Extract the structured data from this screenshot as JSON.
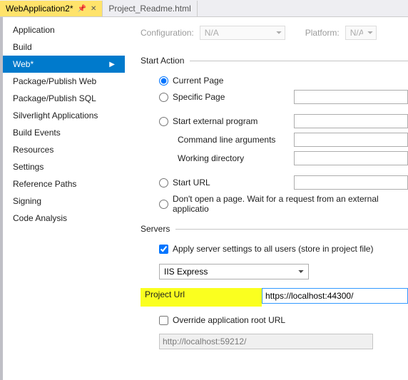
{
  "tabs": {
    "active": "WebApplication2*",
    "other": "Project_Readme.html"
  },
  "sidebar": {
    "items": [
      "Application",
      "Build",
      "Web*",
      "Package/Publish Web",
      "Package/Publish SQL",
      "Silverlight Applications",
      "Build Events",
      "Resources",
      "Settings",
      "Reference Paths",
      "Signing",
      "Code Analysis"
    ],
    "selectedIndex": 2
  },
  "config": {
    "configLabel": "Configuration:",
    "configValue": "N/A",
    "platformLabel": "Platform:",
    "platformValue": "N/A"
  },
  "startAction": {
    "heading": "Start Action",
    "currentPage": "Current Page",
    "specificPage": "Specific Page",
    "startExternal": "Start external program",
    "cmdArgs": "Command line arguments",
    "workDir": "Working directory",
    "startUrl": "Start URL",
    "dontOpen": "Don't open a page.  Wait for a request from an external applicatio"
  },
  "servers": {
    "heading": "Servers",
    "applyAll": "Apply server settings to all users (store in project file)",
    "serverType": "IIS Express",
    "projectUrlLabel": "Project Url",
    "projectUrlValue": "https://localhost:44300/",
    "overrideRoot": "Override application root URL",
    "rootUrlPlaceholder": "http://localhost:59212/"
  }
}
